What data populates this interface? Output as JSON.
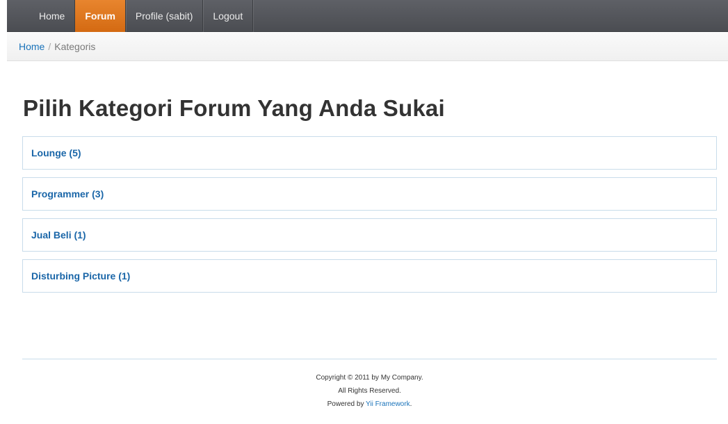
{
  "nav": {
    "items": [
      {
        "label": "Home",
        "active": false
      },
      {
        "label": "Forum",
        "active": true
      },
      {
        "label": "Profile (sabit)",
        "active": false
      },
      {
        "label": "Logout",
        "active": false
      }
    ]
  },
  "breadcrumb": {
    "home": "Home",
    "separator": "/",
    "current": "Kategoris"
  },
  "main": {
    "title": "Pilih Kategori Forum Yang Anda Sukai",
    "categories": [
      {
        "label": "Lounge (5)"
      },
      {
        "label": "Programmer (3)"
      },
      {
        "label": "Jual Beli (1)"
      },
      {
        "label": "Disturbing Picture (1)"
      }
    ]
  },
  "footer": {
    "copyright": "Copyright © 2011 by My Company.",
    "rights": "All Rights Reserved.",
    "powered_prefix": "Powered by ",
    "powered_link": "Yii Framework",
    "powered_suffix": "."
  },
  "colors": {
    "nav_bg": "#55575c",
    "nav_active": "#e07a20",
    "link": "#1a66a8",
    "heading": "#333333",
    "box_border": "#c8dcea"
  }
}
